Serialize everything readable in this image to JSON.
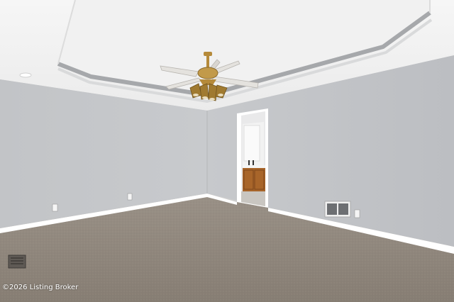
{
  "watermark": {
    "text": "©2026 Listing Broker"
  },
  "colors": {
    "ceiling": "#f4f4f4",
    "wall_left": "#c3c5c8",
    "wall_back": "#c6c8cb",
    "wall_right": "#bdbfc3",
    "trim": "#ffffff",
    "carpet": "#8e857b",
    "tray_molding": "#a4a6a9",
    "fan_brass": "#b58a3a",
    "fan_blade": "#e2e0dc",
    "vanity_wood": "#a8652a"
  },
  "icons": {
    "ceiling_fan": "ceiling-fan-icon",
    "recessed_light": "recessed-light-icon",
    "floor_vent": "floor-vent-icon",
    "wall_vent": "wall-vent-icon",
    "outlet": "outlet-icon"
  }
}
